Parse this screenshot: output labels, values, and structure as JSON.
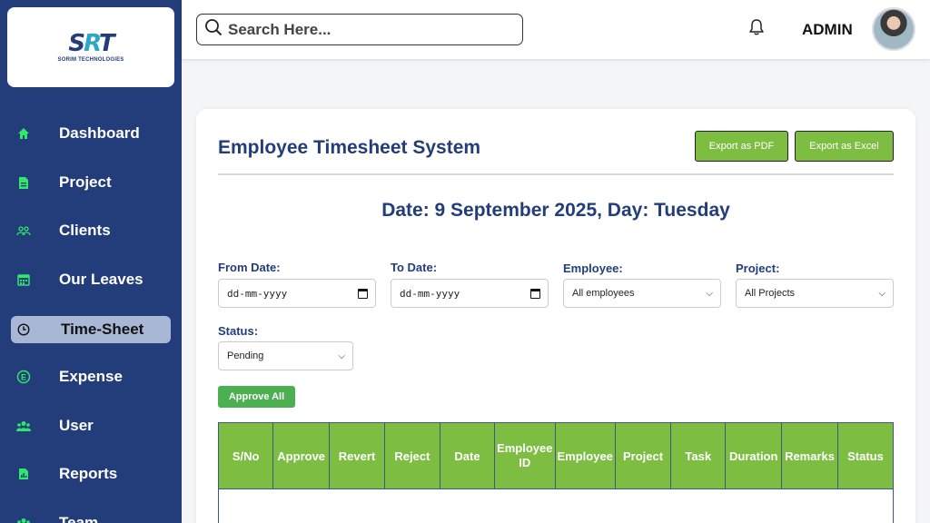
{
  "brand": {
    "mark": "SRT",
    "name": "SORIM TECHNOLOGIES"
  },
  "sidebar": {
    "items": [
      {
        "label": "Dashboard",
        "icon": "home-icon"
      },
      {
        "label": "Project",
        "icon": "document-icon"
      },
      {
        "label": "Clients",
        "icon": "clients-icon"
      },
      {
        "label": "Our Leaves",
        "icon": "calendar-icon"
      },
      {
        "label": "Time-Sheet",
        "icon": "clock-icon",
        "active": true
      },
      {
        "label": "Expense",
        "icon": "expense-icon"
      },
      {
        "label": "User",
        "icon": "users-icon"
      },
      {
        "label": "Reports",
        "icon": "report-icon"
      },
      {
        "label": "Team",
        "icon": "team-icon"
      }
    ]
  },
  "header": {
    "search_placeholder": "Search Here...",
    "user_label": "ADMIN"
  },
  "main": {
    "title": "Employee Timesheet System",
    "export_pdf": "Export as PDF",
    "export_excel": "Export as Excel",
    "date_line": "Date: 9 September 2025, Day: Tuesday",
    "filters": {
      "from_label": "From Date:",
      "from_value": "dd-mm-yyyy",
      "to_label": "To Date:",
      "to_value": "dd-mm-yyyy",
      "employee_label": "Employee:",
      "employee_value": "All employees",
      "project_label": "Project:",
      "project_value": "All Projects",
      "status_label": "Status:",
      "status_value": "Pending"
    },
    "approve_all": "Approve All",
    "table": {
      "columns": [
        "S/No",
        "Approve",
        "Revert",
        "Reject",
        "Date",
        "Employee ID",
        "Employee",
        "Project",
        "Task",
        "Duration",
        "Remarks",
        "Status"
      ]
    }
  },
  "colors": {
    "sidebar": "#223d7a",
    "accent_green": "#7cbd42",
    "title_blue": "#223d7a"
  }
}
